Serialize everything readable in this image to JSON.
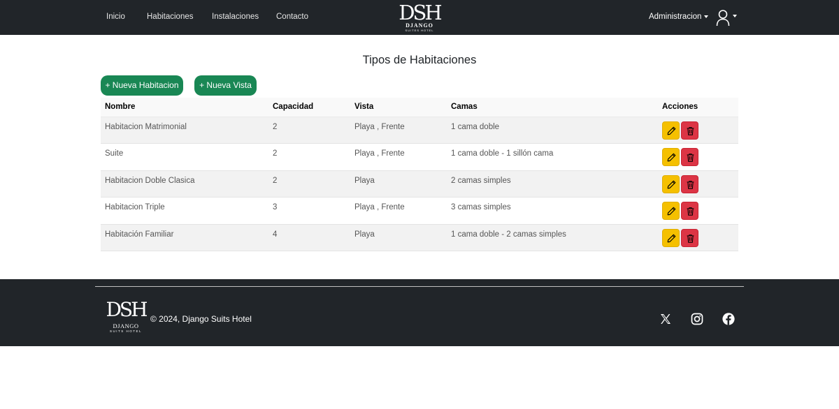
{
  "nav": {
    "links": [
      "Inicio",
      "Habitaciones",
      "Instalaciones",
      "Contacto"
    ],
    "brand": {
      "monogram": "DSH",
      "name": "DJANGO",
      "subtitle": "SUITES HOTEL"
    },
    "admin_label": "Administracion",
    "user_icon": "user-icon"
  },
  "main": {
    "title": "Tipos de Habitaciones",
    "buttons": {
      "new_room": "+ Nueva Habitacion",
      "new_view": "+ Nueva Vista"
    },
    "table": {
      "headers": [
        "Nombre",
        "Capacidad",
        "Vista",
        "Camas",
        "Acciones"
      ],
      "rows": [
        {
          "nombre": "Habitacion Matrimonial",
          "capacidad": "2",
          "vista": "Playa , Frente",
          "camas": "1 cama doble"
        },
        {
          "nombre": "Suite",
          "capacidad": "2",
          "vista": "Playa , Frente",
          "camas": "1 cama doble - 1 sillón cama"
        },
        {
          "nombre": "Habitacion Doble Clasica",
          "capacidad": "2",
          "vista": "Playa",
          "camas": "2 camas simples"
        },
        {
          "nombre": "Habitacion Triple",
          "capacidad": "3",
          "vista": "Playa , Frente",
          "camas": "3 camas simples"
        },
        {
          "nombre": "Habitación Familiar",
          "capacidad": "4",
          "vista": "Playa",
          "camas": "1 cama doble - 2 camas simples"
        }
      ],
      "action_icons": [
        "pencil-icon",
        "trash-icon"
      ]
    }
  },
  "footer": {
    "logo": {
      "monogram": "DSH",
      "name": "DJANGO",
      "subtitle": "SUITS HOTEL"
    },
    "copyright": "© 2024, Django Suits Hotel",
    "social_icons": [
      "x-icon",
      "instagram-icon",
      "facebook-icon"
    ]
  },
  "colors": {
    "navbar": "#212529",
    "primary_green": "#198754",
    "edit_yellow": "#f5c000",
    "delete_red": "#dc3545"
  }
}
